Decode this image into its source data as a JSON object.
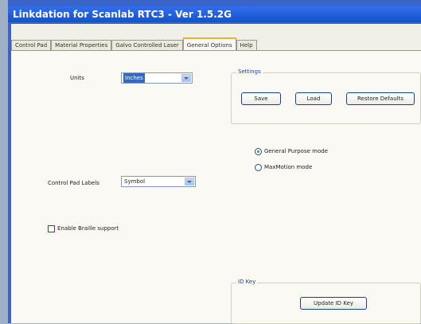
{
  "window": {
    "title": "Linkdation for Scanlab RTC3 - Ver 1.5.2G"
  },
  "tabs": [
    {
      "label": "Control Pad"
    },
    {
      "label": "Material Properties"
    },
    {
      "label": "Galvo Controlled Laser"
    },
    {
      "label": "General Options"
    },
    {
      "label": "Help"
    }
  ],
  "units": {
    "label": "Units",
    "value": "Inches"
  },
  "settings": {
    "legend": "Settings",
    "save": "Save",
    "load": "Load",
    "restore": "Restore Defaults"
  },
  "mode": {
    "general": "General Purpose mode",
    "maxmotion": "MaxMotion mode"
  },
  "control_pad_labels": {
    "label": "Control Pad Labels",
    "value": "Symbol"
  },
  "braille": {
    "label": "Enable Braille support"
  },
  "id_key": {
    "legend": "ID Key",
    "button": "Update ID Key"
  },
  "colors": {
    "accent": "#316ac5",
    "title_bar": "#1a4fc8"
  }
}
